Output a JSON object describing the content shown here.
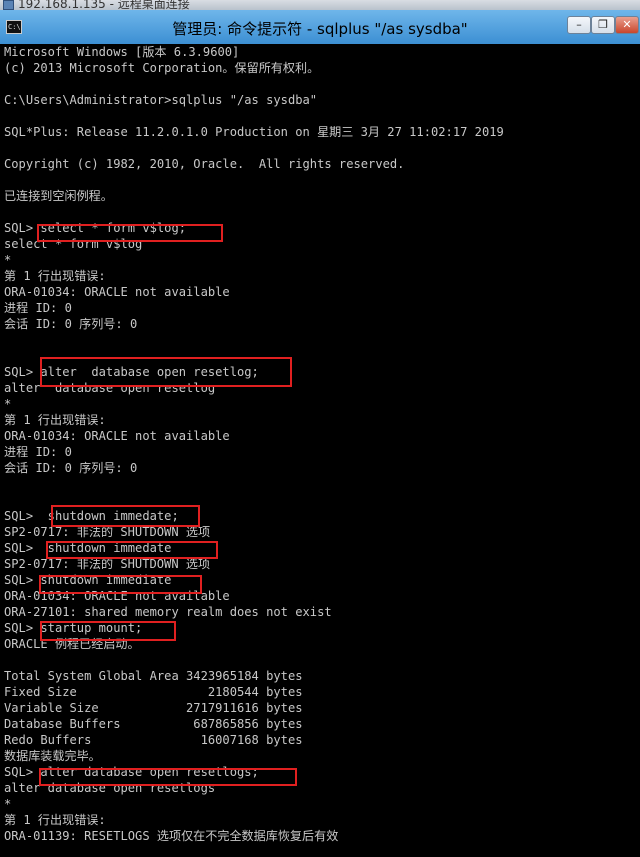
{
  "rdp_bar": {
    "title": "192.168.1.135 - 远程桌面连接"
  },
  "window": {
    "icon_label": "C:\\",
    "title": "管理员: 命令提示符 - sqlplus  \"/as sysdba\"",
    "minimize": "–",
    "maximize": "❐",
    "close": "✕"
  },
  "console": {
    "lines": [
      "Microsoft Windows [版本 6.3.9600]",
      "(c) 2013 Microsoft Corporation。保留所有权利。",
      "",
      "C:\\Users\\Administrator>sqlplus \"/as sysdba\"",
      "",
      "SQL*Plus: Release 11.2.0.1.0 Production on 星期三 3月 27 11:02:17 2019",
      "",
      "Copyright (c) 1982, 2010, Oracle.  All rights reserved.",
      "",
      "已连接到空闲例程。",
      "",
      "SQL> select * form v$log;",
      "select * form v$log",
      "*",
      "第 1 行出现错误:",
      "ORA-01034: ORACLE not available",
      "进程 ID: 0",
      "会话 ID: 0 序列号: 0",
      "",
      "",
      "SQL> alter  database open resetlog;",
      "alter  database open resetlog",
      "*",
      "第 1 行出现错误:",
      "ORA-01034: ORACLE not available",
      "进程 ID: 0",
      "会话 ID: 0 序列号: 0",
      "",
      "",
      "SQL>  shutdown immedate;",
      "SP2-0717: 非法的 SHUTDOWN 选项",
      "SQL>  shutdown immedate",
      "SP2-0717: 非法的 SHUTDOWN 选项",
      "SQL> shutdown immediate",
      "ORA-01034: ORACLE not available",
      "ORA-27101: shared memory realm does not exist",
      "SQL> startup mount;",
      "ORACLE 例程已经启动。",
      "",
      "Total System Global Area 3423965184 bytes",
      "Fixed Size                  2180544 bytes",
      "Variable Size            2717911616 bytes",
      "Database Buffers          687865856 bytes",
      "Redo Buffers               16007168 bytes",
      "数据库装载完毕。",
      "SQL> alter database open resetlogs;",
      "alter database open resetlogs",
      "*",
      "第 1 行出现错误:",
      "ORA-01139: RESETLOGS 选项仅在不完全数据库恢复后有效"
    ]
  },
  "highlight_color": "#e02020"
}
